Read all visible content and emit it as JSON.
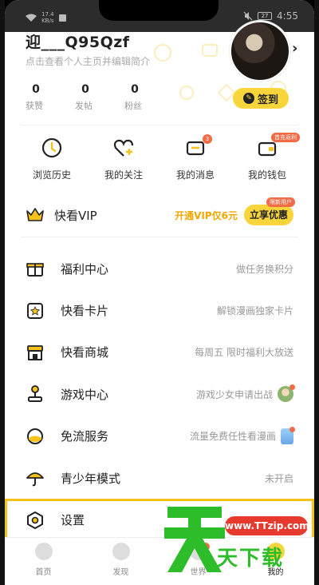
{
  "status_bar": {
    "network_speed": "17.4\nKB/s",
    "battery": "27",
    "time": "4:55"
  },
  "profile": {
    "username": "迎___Q95Qzf",
    "level_badge": "",
    "subtitle": "点击查看个人主页并编辑简介",
    "stats": [
      {
        "value": "0",
        "label": "获赞"
      },
      {
        "value": "0",
        "label": "发帖"
      },
      {
        "value": "0",
        "label": "粉丝"
      }
    ],
    "signin_label": "签到"
  },
  "quick_actions": [
    {
      "label": "浏览历史",
      "icon": "clock-icon"
    },
    {
      "label": "我的关注",
      "icon": "heart-plus-icon"
    },
    {
      "label": "我的消息",
      "icon": "message-icon",
      "badge": "3"
    },
    {
      "label": "我的钱包",
      "icon": "wallet-icon",
      "tag": "首充返利"
    }
  ],
  "vip": {
    "label": "快看VIP",
    "promo": "开通VIP仅6元",
    "button_label": "立享优惠",
    "button_tag": "限新用户"
  },
  "menu": [
    {
      "label": "福利中心",
      "hint": "做任务换积分",
      "icon": "gift-icon"
    },
    {
      "label": "快看卡片",
      "hint": "解锁漫画独家卡片",
      "icon": "card-star-icon"
    },
    {
      "label": "快看商城",
      "hint": "每周五 限时福利大放送",
      "icon": "store-icon"
    },
    {
      "label": "游戏中心",
      "hint": "游戏少女申请出战",
      "icon": "joystick-icon"
    },
    {
      "label": "免流服务",
      "hint": "流量免费任性看漫画",
      "icon": "data-free-icon"
    },
    {
      "label": "青少年模式",
      "hint": "未开启",
      "icon": "umbrella-icon"
    },
    {
      "label": "设置",
      "hint": "",
      "icon": "settings-icon"
    }
  ],
  "bottom_nav": [
    {
      "label": "首页",
      "icon": "home-icon"
    },
    {
      "label": "发现",
      "icon": "discover-icon"
    },
    {
      "label": "世界",
      "icon": "world-icon",
      "badge": "1"
    },
    {
      "label": "我的",
      "icon": "profile-icon"
    }
  ],
  "watermark": {
    "url": "www.TTzip.com",
    "text": "天下载"
  },
  "colors": {
    "accent_yellow": "#f8d63b",
    "badge_red": "#f36b46",
    "promo_orange": "#f0a800",
    "highlight_outline": "#f6c31c"
  }
}
